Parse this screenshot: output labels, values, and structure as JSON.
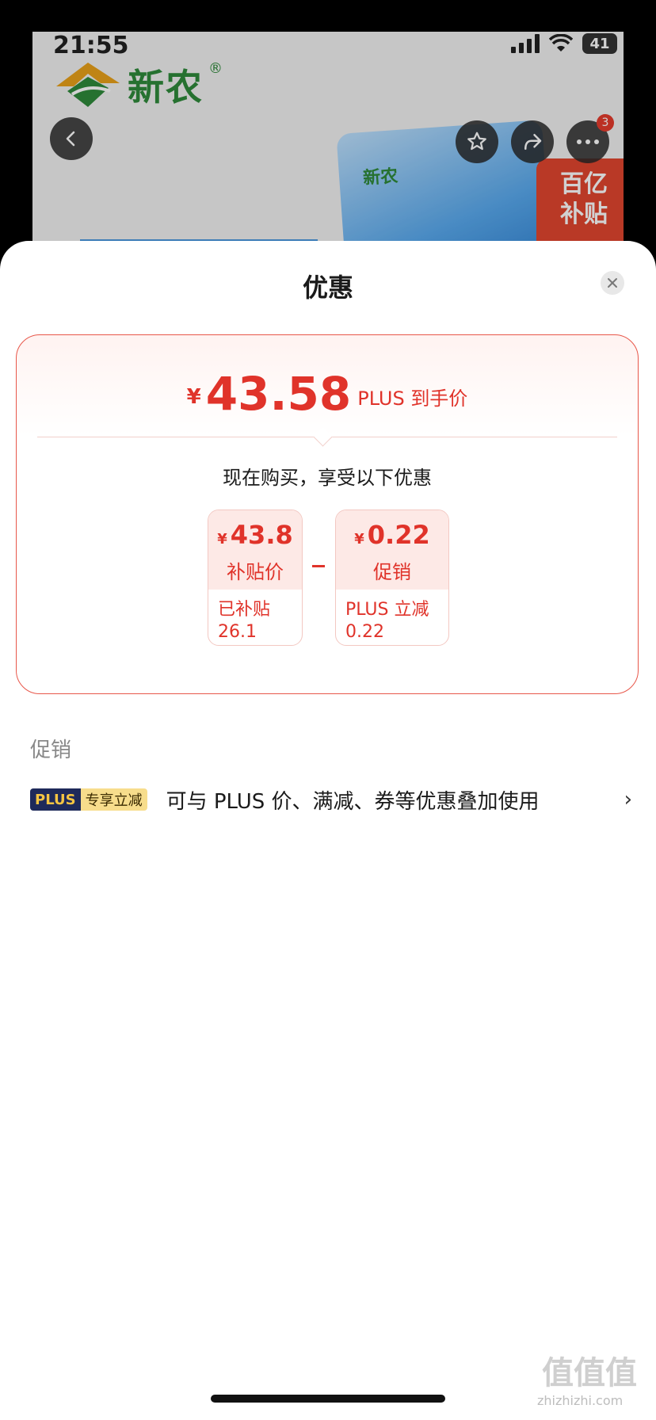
{
  "status_bar": {
    "time": "21:55",
    "battery": "41"
  },
  "product_header": {
    "brand_name": "新农",
    "brand_reg": "®",
    "bag_logo": "新农",
    "subsidy_tag": "百亿\n补贴",
    "more_badge": "3"
  },
  "sheet": {
    "title": "优惠",
    "final_price": {
      "currency": "¥",
      "amount": "43.58",
      "label": "PLUS 到手价"
    },
    "promo_description": "现在购买，享受以下优惠",
    "discounts": [
      {
        "currency": "¥",
        "value": "43.8",
        "name": "补贴价",
        "detail_line1": "已补贴",
        "detail_line2": "26.1"
      },
      {
        "currency": "¥",
        "value": "0.22",
        "name": "促销",
        "detail_line1": "PLUS 立减",
        "detail_line2": "0.22"
      }
    ],
    "section_label": "促销",
    "promo_row": {
      "tag_plus": "PLUS",
      "tag_text": "专享立减",
      "text": "可与 PLUS 价、满减、券等优惠叠加使用",
      "chevron": "›"
    }
  },
  "watermark": {
    "text": "值值值",
    "url": "zhizhizhi.com"
  },
  "colors": {
    "accent_red": "#e0332a",
    "plus_dark": "#1e2a5a",
    "plus_gold": "#f7dd8c",
    "brand_green": "#2f8a3b"
  }
}
